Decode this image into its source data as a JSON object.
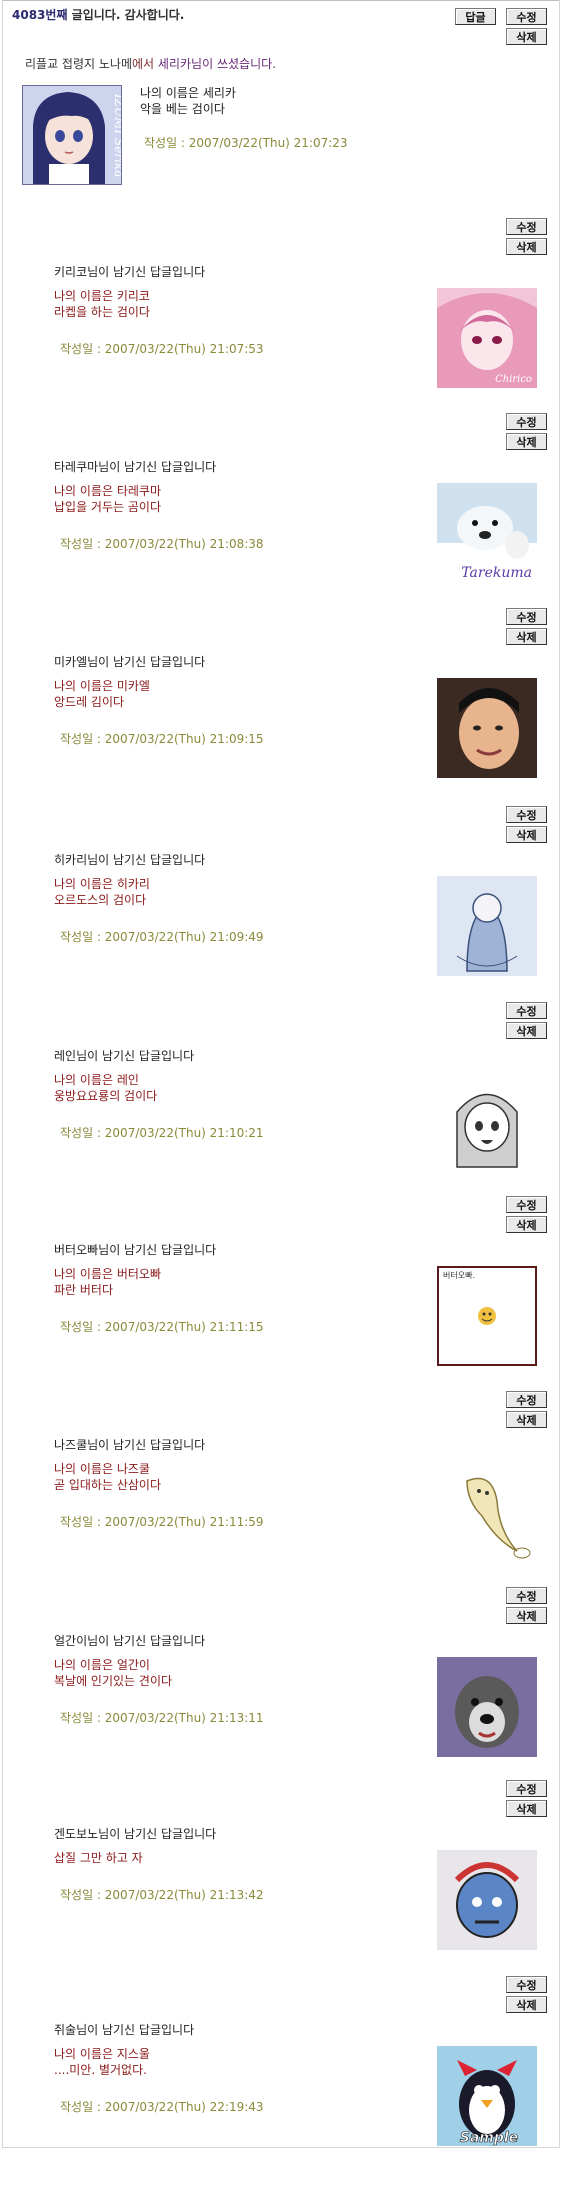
{
  "header": {
    "post_number": "4083번째",
    "message": "글입니다. 감사합니다."
  },
  "buttons": {
    "reply": "답글",
    "edit": "수정",
    "delete": "삭제"
  },
  "origin": {
    "board": "리플교 접령지 노나메",
    "from": "에서",
    "author": "세리카님이",
    "wrote": "쓰셨습니다."
  },
  "post": {
    "line1": "나의 이름은 세리카",
    "line2": "악을 베는 검이다",
    "date": "작성일 : 2007/03/22(Thu) 21:07:23",
    "avatar_caption": "IZUMI Serika"
  },
  "replies": [
    {
      "title": "키리코님이 남기신 답글입니다",
      "line1": "나의 이름은 키리코",
      "line2": "라켑을 하는 검이다",
      "date": "작성일 : 2007/03/22(Thu) 21:07:53",
      "avatar": "pink-anime-avatar",
      "caption": "Chirico",
      "bg": "#f2c6d8"
    },
    {
      "title": "타레쿠마님이 남기신 답글입니다",
      "line1": "나의 이름은 타레쿠마",
      "line2": "납입을 거두는 곰이다",
      "date": "작성일 : 2007/03/22(Thu) 21:08:38",
      "avatar": "polar-bear-avatar",
      "caption": "Tarekuma",
      "bg": "#cfe1ee"
    },
    {
      "title": "미카엘님이 남기신 답글입니다",
      "line1": "나의 이름은 미카엘",
      "line2": "앙드레 김이다",
      "date": "작성일 : 2007/03/22(Thu) 21:09:15",
      "avatar": "man-face-avatar",
      "caption": "",
      "bg": "#e9c9a8"
    },
    {
      "title": "히카리님이 남기신 답글입니다",
      "line1": "나의 이름은 히카리",
      "line2": "오르도스의 검이다",
      "date": "작성일 : 2007/03/22(Thu) 21:09:49",
      "avatar": "sketch-girl-avatar",
      "caption": "",
      "bg": "#dde6f2"
    },
    {
      "title": "레인님이 남기신 답글입니다",
      "line1": "나의 이름은 레인",
      "line2": "웅방요요룡의 검이다",
      "date": "작성일 : 2007/03/22(Thu) 21:10:21",
      "avatar": "manga-girl-avatar",
      "caption": "",
      "bg": "#ffffff"
    },
    {
      "title": "버터오빠님이 남기신 답글입니다",
      "line1": "나의 이름은 버터오빠",
      "line2": "파란 버터다",
      "date": "작성일 : 2007/03/22(Thu) 21:11:15",
      "avatar": "smiley-avatar",
      "caption": "버터오빠.",
      "bg": "#ffffff"
    },
    {
      "title": "나즈쿨님이 남기신 답글입니다",
      "line1": "나의 이름은 나즈쿨",
      "line2": "곧 입대하는 산삼이다",
      "date": "작성일 : 2007/03/22(Thu) 21:11:59",
      "avatar": "ginseng-avatar",
      "caption": "",
      "bg": "#ffffff"
    },
    {
      "title": "얼간이님이 남기신 답글입니다",
      "line1": "나의 이름은 얼간이",
      "line2": "복날에 인기있는 견이다",
      "date": "작성일 : 2007/03/22(Thu) 21:13:11",
      "avatar": "dog-avatar",
      "caption": "",
      "bg": "#7a6ea0"
    },
    {
      "title": "겐도보노님이 남기신 답글입니다",
      "line1": "삽질 그만 하고 자",
      "line2": "",
      "date": "작성일 : 2007/03/22(Thu) 21:13:42",
      "avatar": "graffiti-avatar",
      "caption": "",
      "bg": "#e8e6ea"
    },
    {
      "title": "쥐술님이 남기신 답글입니다",
      "line1": "나의 이름은 지스울",
      "line2": "....미안. 별거없다.",
      "date": "작성일 : 2007/03/22(Thu) 22:19:43",
      "avatar": "penguin-avatar",
      "caption": "Sample",
      "bg": "#9fd0e8"
    }
  ]
}
